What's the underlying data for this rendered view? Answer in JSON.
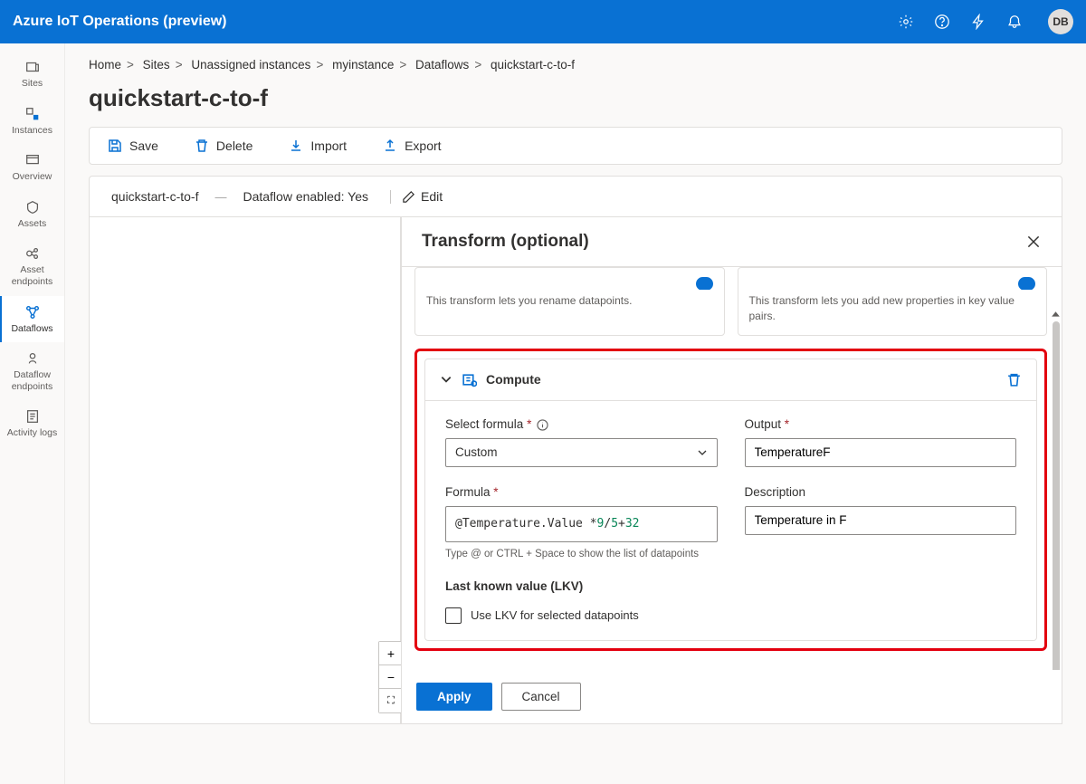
{
  "header": {
    "title": "Azure IoT Operations (preview)",
    "avatar": "DB"
  },
  "nav": {
    "items": [
      {
        "label": "Sites"
      },
      {
        "label": "Instances"
      },
      {
        "label": "Overview"
      },
      {
        "label": "Assets"
      },
      {
        "label": "Asset endpoints"
      },
      {
        "label": "Dataflows"
      },
      {
        "label": "Dataflow endpoints"
      },
      {
        "label": "Activity logs"
      }
    ]
  },
  "breadcrumbs": {
    "items": [
      "Home",
      "Sites",
      "Unassigned instances",
      "myinstance",
      "Dataflows",
      "quickstart-c-to-f"
    ]
  },
  "page": {
    "title": "quickstart-c-to-f",
    "toolbar": {
      "save": "Save",
      "delete": "Delete",
      "import": "Import",
      "export": "Export"
    },
    "status": {
      "name": "quickstart-c-to-f",
      "enabled": "Dataflow enabled: Yes",
      "edit": "Edit"
    }
  },
  "panel": {
    "heading": "Transform (optional)",
    "tiles": {
      "rename": {
        "desc": "This transform lets you rename datapoints."
      },
      "newprop": {
        "desc": "This transform lets you add new properties in key value pairs."
      }
    },
    "compute": {
      "title": "Compute",
      "fields": {
        "selectFormulaLabel": "Select formula",
        "selectFormulaValue": "Custom",
        "outputLabel": "Output",
        "outputValue": "TemperatureF",
        "formulaLabel": "Formula",
        "formulaPrefix": "@Temperature.Value * ",
        "formulaN1": "9",
        "formulaSlash": "/",
        "formulaN2": "5",
        "formulaPlus": " + ",
        "formulaN3": "32",
        "formulaHint": "Type @ or CTRL + Space to show the list of datapoints",
        "descLabel": "Description",
        "descValue": "Temperature in F",
        "lkvHeading": "Last known value (LKV)",
        "lkvCheckbox": "Use LKV for selected datapoints"
      }
    },
    "footer": {
      "apply": "Apply",
      "cancel": "Cancel"
    }
  }
}
